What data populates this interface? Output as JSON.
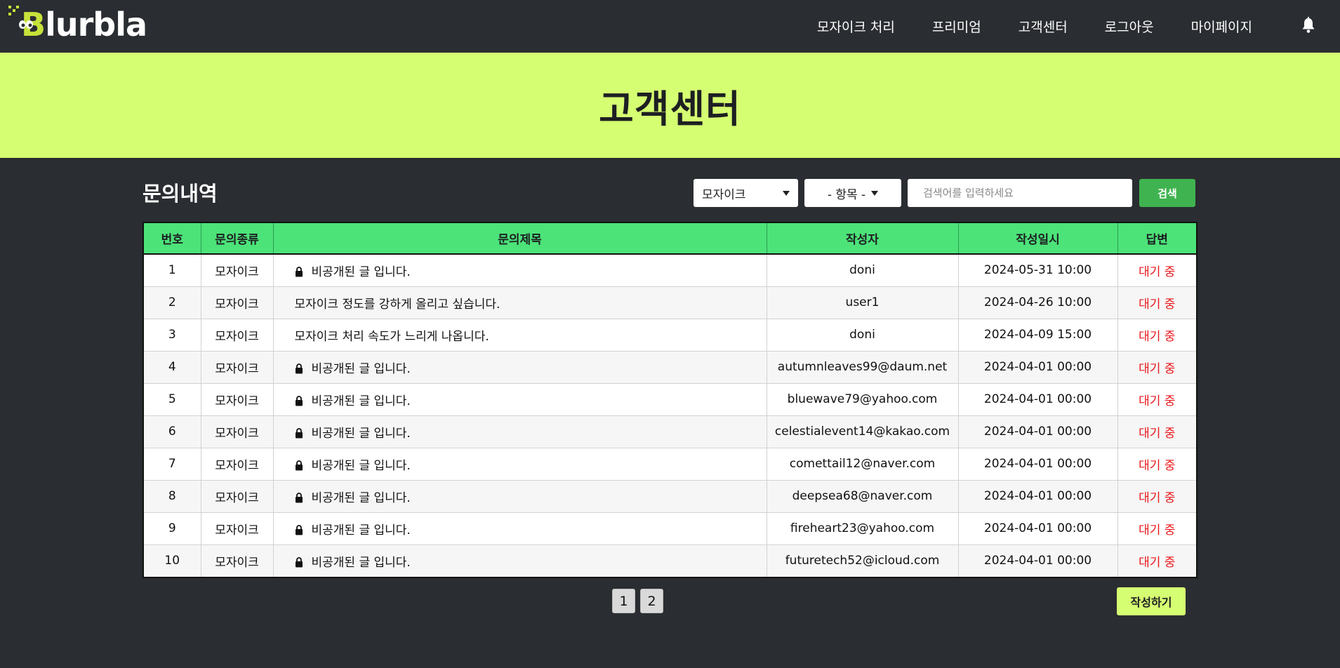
{
  "brand": {
    "name": "Blurbla",
    "first_letter": "B",
    "rest": "lurbla",
    "accent": "#c6e23a"
  },
  "nav": {
    "items": [
      "모자이크 처리",
      "프리미엄",
      "고객센터",
      "로그아웃",
      "마이페이지"
    ],
    "bell_icon": "bell-icon"
  },
  "banner": {
    "title": "고객센터",
    "color": "#d5fe72"
  },
  "inquiry": {
    "section_title": "문의내역",
    "filter_category": "모자이크",
    "filter_field": "- 항목 -",
    "search_placeholder": "검색어를 입력하세요",
    "search_button": "검색",
    "columns": [
      "번호",
      "문의종류",
      "문의제목",
      "작성자",
      "작성일시",
      "답변"
    ],
    "rows": [
      {
        "no": "1",
        "type": "모자이크",
        "locked": true,
        "title": "비공개된 글 입니다.",
        "author": "doni",
        "date": "2024-05-31 10:00",
        "status": "대기 중"
      },
      {
        "no": "2",
        "type": "모자이크",
        "locked": false,
        "title": "모자이크 정도를 강하게 올리고 싶습니다.",
        "author": "user1",
        "date": "2024-04-26 10:00",
        "status": "대기 중"
      },
      {
        "no": "3",
        "type": "모자이크",
        "locked": false,
        "title": "모자이크 처리 속도가 느리게 나옵니다.",
        "author": "doni",
        "date": "2024-04-09 15:00",
        "status": "대기 중"
      },
      {
        "no": "4",
        "type": "모자이크",
        "locked": true,
        "title": "비공개된 글 입니다.",
        "author": "autumnleaves99@daum.net",
        "date": "2024-04-01 00:00",
        "status": "대기 중"
      },
      {
        "no": "5",
        "type": "모자이크",
        "locked": true,
        "title": "비공개된 글 입니다.",
        "author": "bluewave79@yahoo.com",
        "date": "2024-04-01 00:00",
        "status": "대기 중"
      },
      {
        "no": "6",
        "type": "모자이크",
        "locked": true,
        "title": "비공개된 글 입니다.",
        "author": "celestialevent14@kakao.com",
        "date": "2024-04-01 00:00",
        "status": "대기 중"
      },
      {
        "no": "7",
        "type": "모자이크",
        "locked": true,
        "title": "비공개된 글 입니다.",
        "author": "comettail12@naver.com",
        "date": "2024-04-01 00:00",
        "status": "대기 중"
      },
      {
        "no": "8",
        "type": "모자이크",
        "locked": true,
        "title": "비공개된 글 입니다.",
        "author": "deepsea68@naver.com",
        "date": "2024-04-01 00:00",
        "status": "대기 중"
      },
      {
        "no": "9",
        "type": "모자이크",
        "locked": true,
        "title": "비공개된 글 입니다.",
        "author": "fireheart23@yahoo.com",
        "date": "2024-04-01 00:00",
        "status": "대기 중"
      },
      {
        "no": "10",
        "type": "모자이크",
        "locked": true,
        "title": "비공개된 글 입니다.",
        "author": "futuretech52@icloud.com",
        "date": "2024-04-01 00:00",
        "status": "대기 중"
      }
    ],
    "status_color": "#e8171b",
    "header_color": "#4ce379"
  },
  "pagination": {
    "pages": [
      "1",
      "2"
    ]
  },
  "write_button": "작성하기"
}
